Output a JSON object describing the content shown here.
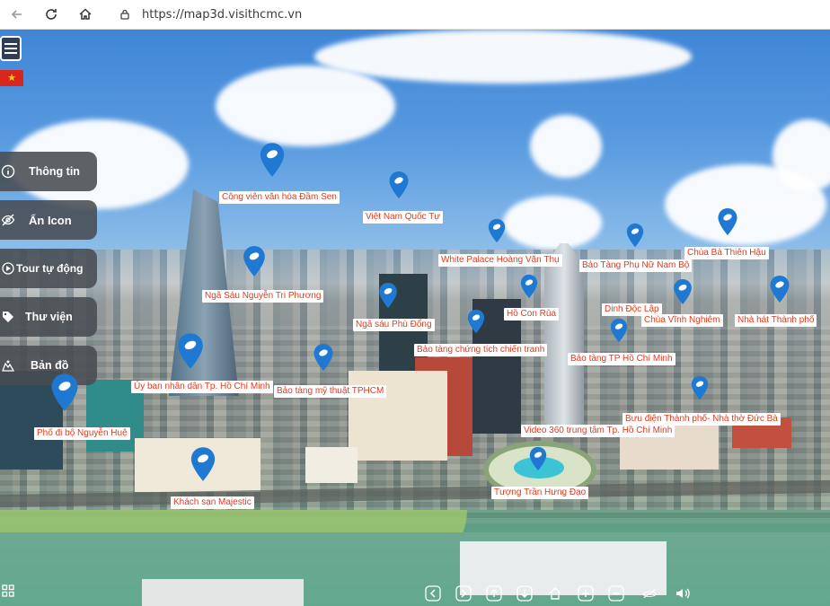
{
  "browser": {
    "url": "https://map3d.visithcmc.vn"
  },
  "sidebar": {
    "items": [
      {
        "label": "Thông tin",
        "icon": "info-icon"
      },
      {
        "label": "Ẩn Icon",
        "icon": "eye-slash-icon"
      },
      {
        "label": "Tour tự động",
        "icon": "tour-icon"
      },
      {
        "label": "Thư viện",
        "icon": "tag-icon"
      },
      {
        "label": "Bản đồ",
        "icon": "map-icon"
      }
    ]
  },
  "places": [
    {
      "name": "Công viên văn hóa Đầm Sen"
    },
    {
      "name": "Việt Nam Quốc Tự"
    },
    {
      "name": "White Palace Hoàng Văn Thụ"
    },
    {
      "name": "Bảo Tàng Phụ Nữ Nam Bộ"
    },
    {
      "name": "Chùa Bà Thiên Hậu"
    },
    {
      "name": "Ngã Sáu Nguyễn Tri Phương"
    },
    {
      "name": "Hồ Con Rùa"
    },
    {
      "name": "Dinh Độc Lập"
    },
    {
      "name": "Ngã sáu Phù Đổng"
    },
    {
      "name": "Chùa Vĩnh Nghiêm"
    },
    {
      "name": "Nhà hát Thành phố"
    },
    {
      "name": "Bảo tàng chứng tích chiến tranh"
    },
    {
      "name": "Bảo tàng TP Hồ Chí Minh"
    },
    {
      "name": "Ủy ban nhân dân Tp. Hồ Chí Minh"
    },
    {
      "name": "Bảo tàng mỹ thuật TPHCM"
    },
    {
      "name": "Bưu điện Thành phố- Nhà thờ Đức Bà"
    },
    {
      "name": "Phố đi bộ Nguyễn Huệ"
    },
    {
      "name": "Video 360 trung tâm Tp. Hồ Chí Minh"
    },
    {
      "name": "Khách sạn Majestic"
    },
    {
      "name": "Tượng Trần Hưng Đạo"
    }
  ],
  "colors": {
    "pin": "#1f78d1",
    "label_text": "#e2391c",
    "menu_bg": "#484c52"
  }
}
